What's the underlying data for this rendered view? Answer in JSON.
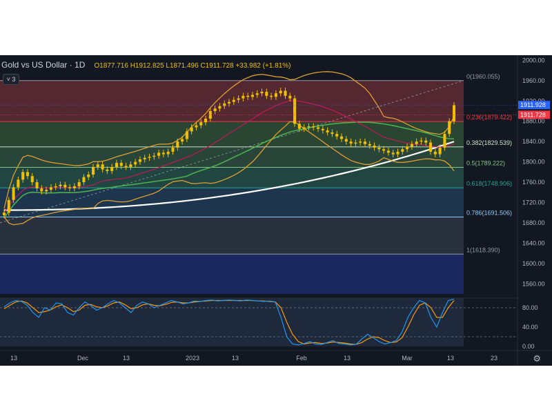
{
  "header": {
    "symbol": "Gold vs US Dollar · 1D",
    "ohlc": "O1877.716 H1912.825 L1871.496 C1911.728 +33.982 (+1.81%)",
    "indicator_count": "3"
  },
  "colors": {
    "background": "#131722",
    "candle": "#f0c000",
    "bollinger": "#e0a030",
    "ma_fast": "#c2185b",
    "ma_mid": "#4caf50",
    "ma_slow": "#ffffff",
    "stoch_k": "#2196f3",
    "stoch_d": "#ff9800"
  },
  "icons": {
    "settings": "gear-icon"
  },
  "chart_data": [
    {
      "type": "candlestick",
      "title": "Gold vs US Dollar · 1D",
      "x_labels": [
        "13",
        "Dec",
        "13",
        "2023",
        "13",
        "Feb",
        "13",
        "Mar",
        "13",
        "23"
      ],
      "y_ticks": [
        1560,
        1600,
        1640,
        1680,
        1720,
        1760,
        1800,
        1840,
        1880,
        1920,
        1960,
        2000
      ],
      "ylim": [
        1540,
        2010
      ],
      "price_labels": [
        {
          "text": "1911.928",
          "value": 1911.928,
          "color": "#2962ff"
        },
        {
          "text": "1911.728",
          "value": 1911.728,
          "color": "#f23645"
        }
      ],
      "fibonacci": [
        {
          "text": "0(1960.055)",
          "value": 1960.055,
          "color": "#9598a1"
        },
        {
          "text": "0.236(1879.422)",
          "value": 1879.422,
          "color": "#f23645"
        },
        {
          "text": "0.382(1829.539)",
          "value": 1829.539,
          "color": "#c8e6c9"
        },
        {
          "text": "0.5(1789.222)",
          "value": 1789.222,
          "color": "#81c784"
        },
        {
          "text": "0.618(1748.906)",
          "value": 1748.906,
          "color": "#26a69a"
        },
        {
          "text": "0.786(1691.506)",
          "value": 1691.506,
          "color": "#90caf9"
        },
        {
          "text": "1(1618.390)",
          "value": 1618.39,
          "color": "#9598a1"
        }
      ],
      "close": [
        1700,
        1725,
        1750,
        1765,
        1780,
        1772,
        1760,
        1748,
        1742,
        1745,
        1750,
        1752,
        1755,
        1750,
        1748,
        1752,
        1760,
        1770,
        1775,
        1790,
        1795,
        1785,
        1782,
        1790,
        1798,
        1792,
        1790,
        1795,
        1800,
        1805,
        1808,
        1810,
        1812,
        1818,
        1815,
        1820,
        1828,
        1840,
        1845,
        1860,
        1868,
        1872,
        1878,
        1885,
        1900,
        1905,
        1910,
        1915,
        1918,
        1922,
        1925,
        1930,
        1928,
        1932,
        1935,
        1938,
        1930,
        1928,
        1935,
        1940,
        1930,
        1925,
        1875,
        1865,
        1868,
        1870,
        1868,
        1865,
        1862,
        1858,
        1855,
        1850,
        1845,
        1840,
        1836,
        1838,
        1840,
        1835,
        1832,
        1828,
        1825,
        1822,
        1818,
        1815,
        1820,
        1825,
        1830,
        1835,
        1840,
        1842,
        1838,
        1820,
        1815,
        1828,
        1855,
        1880,
        1911.728
      ],
      "stoch_levels": [
        80,
        20
      ],
      "stoch_ticks": [
        0,
        40,
        80
      ],
      "stoch_k": [
        82,
        90,
        95,
        93,
        85,
        70,
        60,
        80,
        75,
        90,
        88,
        70,
        65,
        80,
        92,
        85,
        75,
        80,
        88,
        95,
        90,
        80,
        70,
        85,
        92,
        88,
        80,
        85,
        90,
        95,
        92,
        88,
        90,
        94,
        93,
        95,
        96,
        94,
        95,
        96,
        95,
        94,
        96,
        95,
        94,
        93,
        94,
        92,
        60,
        20,
        5,
        3,
        6,
        10,
        5,
        4,
        8,
        12,
        6,
        5,
        3,
        4,
        15,
        25,
        18,
        10,
        5,
        8,
        12,
        30,
        60,
        80,
        95,
        90,
        60,
        40,
        70,
        95,
        98
      ],
      "stoch_d": [
        78,
        85,
        92,
        94,
        90,
        80,
        70,
        72,
        75,
        82,
        86,
        80,
        72,
        75,
        85,
        87,
        82,
        80,
        84,
        90,
        92,
        86,
        78,
        80,
        86,
        88,
        85,
        84,
        87,
        91,
        92,
        90,
        90,
        92,
        93,
        94,
        95,
        95,
        95,
        95,
        95,
        95,
        95,
        95,
        94,
        94,
        93,
        92,
        80,
        50,
        25,
        10,
        5,
        7,
        8,
        6,
        7,
        9,
        8,
        7,
        5,
        4,
        8,
        15,
        20,
        18,
        12,
        8,
        9,
        18,
        40,
        65,
        85,
        90,
        80,
        60,
        60,
        80,
        95
      ]
    }
  ]
}
